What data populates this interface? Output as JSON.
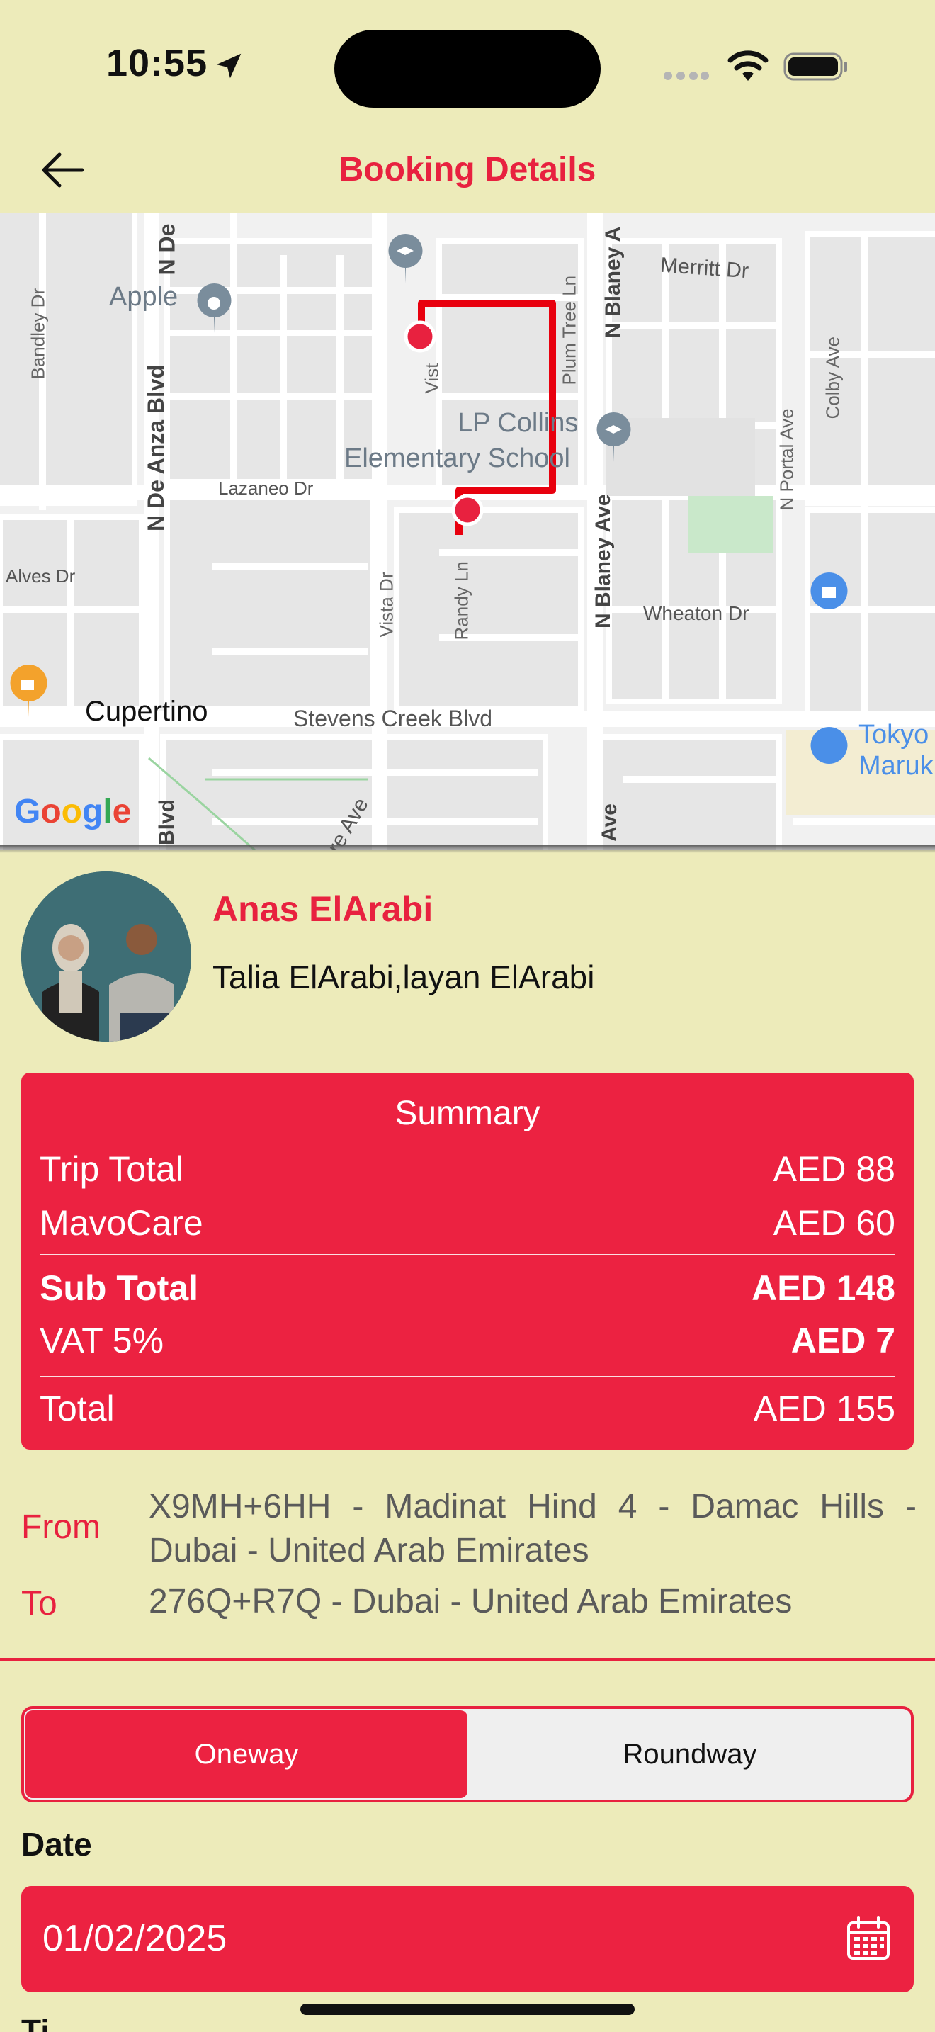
{
  "status_bar": {
    "time": "10:55"
  },
  "nav": {
    "title": "Booking Details"
  },
  "map": {
    "labels": {
      "apple": "Apple",
      "merritt": "Merritt Dr",
      "bandley": "Bandley Dr",
      "de_anza": "N De Anza Blvd",
      "de_anza_top": "N De",
      "vista_short": "Vist",
      "plum_tree": "Plum Tree Ln",
      "blaney_top": "N Blaney A",
      "colby": "Colby Ave",
      "lp_collins_1": "LP Collins",
      "lp_collins_2": "Elementary School",
      "lazaneo": "Lazaneo Dr",
      "portal": "N Portal Ave",
      "alves": "Alves Dr",
      "vista": "Vista Dr",
      "randy": "Randy Ln",
      "blaney": "N Blaney Ave",
      "wheaton": "Wheaton Dr",
      "cupertino": "Cupertino",
      "stevens_creek": "Stevens Creek Blvd",
      "tokyo_1": "Tokyo",
      "tokyo_2": "Maruk",
      "blvd_bottom": "Blvd",
      "ave_bottom": "Ave",
      "tre_ave": "tre Ave",
      "google": "Google"
    }
  },
  "profile": {
    "name": "Anas ElArabi",
    "passengers": "Talia ElArabi,layan ElArabi"
  },
  "summary": {
    "title": "Summary",
    "rows": [
      {
        "label": "Trip Total",
        "value": "AED 88"
      },
      {
        "label": "MavoCare",
        "value": "AED 60"
      },
      {
        "label": "Sub Total",
        "value": "AED 148"
      },
      {
        "label": "VAT 5%",
        "value": "AED 7"
      },
      {
        "label": "Total",
        "value": "AED 155"
      }
    ]
  },
  "route": {
    "from_label": "From",
    "from_value": "X9MH+6HH - Madinat Hind 4 - Damac Hills - Dubai - United Arab Emirates",
    "to_label": "To",
    "to_value": "276Q+R7Q - Dubai - United Arab Emirates"
  },
  "trip_type": {
    "oneway": "Oneway",
    "roundway": "Roundway",
    "selected": "Oneway"
  },
  "date": {
    "label": "Date",
    "value": "01/02/2025"
  },
  "next_section": {
    "label": "Ti"
  },
  "colors": {
    "accent": "#E8213F",
    "card": "#EC2241",
    "background": "#EDEBBA"
  }
}
